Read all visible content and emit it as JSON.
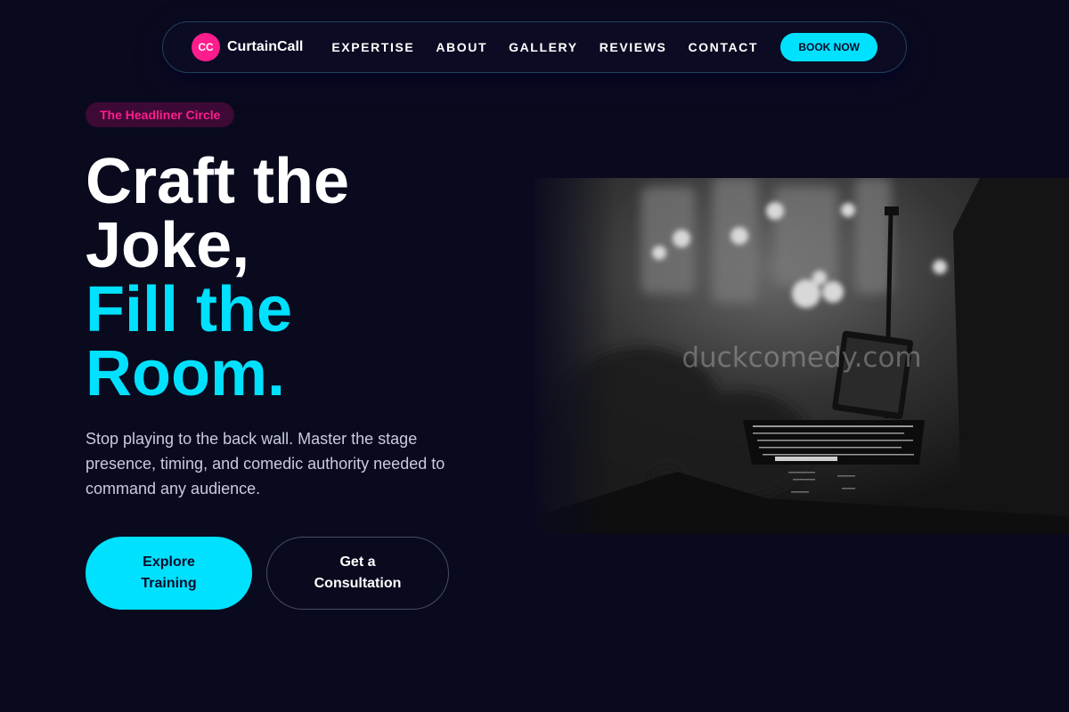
{
  "brand": {
    "initials": "CC",
    "name": "CurtainCall"
  },
  "nav": {
    "links": [
      "EXPERTISE",
      "ABOUT",
      "GALLERY",
      "REVIEWS",
      "CONTACT"
    ],
    "cta": "BOOK NOW"
  },
  "hero": {
    "pill": "The Headliner Circle",
    "headline_line1": "Craft the",
    "headline_line2": "Joke,",
    "headline_line3": "Fill the",
    "headline_line4": "Room.",
    "lede": "Stop playing to the back wall. Master the stage presence, timing, and comedic authority needed to command any audience.",
    "primary_cta": "Explore Training",
    "secondary_cta": "Get a Consultation",
    "image_watermark": "duckcomedy.com",
    "image_icon": "comedy-club-stage-photo"
  },
  "colors": {
    "background": "#0a0a1f",
    "accent_cyan": "#00e1ff",
    "accent_pink": "#ff1c8d"
  }
}
